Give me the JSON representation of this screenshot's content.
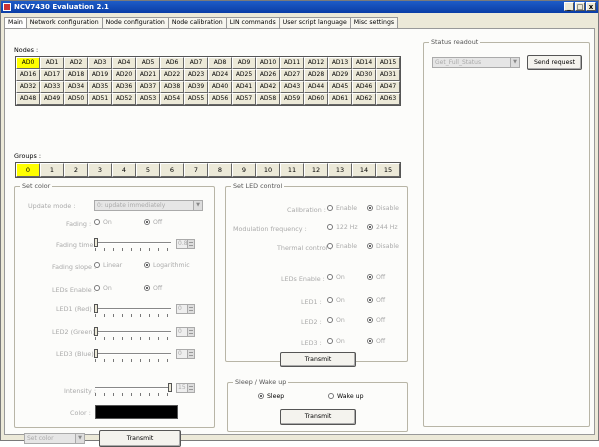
{
  "window": {
    "title": "NCV7430 Evaluation 2.1",
    "min": "_",
    "max": "□",
    "close": "x"
  },
  "tabs": [
    "Main",
    "Network configuration",
    "Node configuration",
    "Node calibration",
    "LIN commands",
    "User script language",
    "Misc settings"
  ],
  "nodes": {
    "label": "Nodes :",
    "selected": "AD0",
    "items": [
      "AD0",
      "AD1",
      "AD2",
      "AD3",
      "AD4",
      "AD5",
      "AD6",
      "AD7",
      "AD8",
      "AD9",
      "AD10",
      "AD11",
      "AD12",
      "AD13",
      "AD14",
      "AD15",
      "AD16",
      "AD17",
      "AD18",
      "AD19",
      "AD20",
      "AD21",
      "AD22",
      "AD23",
      "AD24",
      "AD25",
      "AD26",
      "AD27",
      "AD28",
      "AD29",
      "AD30",
      "AD31",
      "AD32",
      "AD33",
      "AD34",
      "AD35",
      "AD36",
      "AD37",
      "AD38",
      "AD39",
      "AD40",
      "AD41",
      "AD42",
      "AD43",
      "AD44",
      "AD45",
      "AD46",
      "AD47",
      "AD48",
      "AD49",
      "AD50",
      "AD51",
      "AD52",
      "AD53",
      "AD54",
      "AD55",
      "AD56",
      "AD57",
      "AD58",
      "AD59",
      "AD60",
      "AD61",
      "AD62",
      "AD63"
    ]
  },
  "groups": {
    "label": "Groups :",
    "selected": "0",
    "items": [
      "0",
      "1",
      "2",
      "3",
      "4",
      "5",
      "6",
      "7",
      "8",
      "9",
      "10",
      "11",
      "12",
      "13",
      "14",
      "15"
    ]
  },
  "set_color": {
    "title": "Set color",
    "update_mode_label": "Update mode :",
    "update_mode_value": "0: update immediately",
    "fading_label": "Fading :",
    "fading_on": "On",
    "fading_off": "Off",
    "fading_time_label": "Fading time :",
    "fading_time_value": "0.8",
    "fading_slope_label": "Fading slope :",
    "slope_linear": "Linear",
    "slope_log": "Logarithmic",
    "leds_enable_label": "LEDs Enable :",
    "leds_on": "On",
    "leds_off": "Off",
    "led1_label": "LED1 (Red) :",
    "led1_value": "0",
    "led2_label": "LED2 (Green) :",
    "led2_value": "0",
    "led3_label": "LED3 (Blue) :",
    "led3_value": "0",
    "intensity_label": "Intensity :",
    "intensity_value": "15",
    "color_label": "Color :",
    "color_hex": "#000000",
    "command_value": "Set color",
    "transmit": "Transmit"
  },
  "set_led_control": {
    "title": "Set LED control",
    "calibration_label": "Calibration :",
    "enable": "Enable",
    "disable": "Disable",
    "mod_freq_label": "Modulation frequency :",
    "freq_122": "122 Hz",
    "freq_244": "244 Hz",
    "thermal_label": "Thermal control :",
    "leds_enable_label": "LEDs Enable :",
    "on": "On",
    "off": "Off",
    "led1_label": "LED1 :",
    "led2_label": "LED2 :",
    "led3_label": "LED3 :",
    "transmit": "Transmit"
  },
  "sleep_wake": {
    "title": "Sleep / Wake up",
    "sleep": "Sleep",
    "wake": "Wake up",
    "transmit": "Transmit"
  },
  "status_readout": {
    "title": "Status readout",
    "combo_value": "Get_Full_Status",
    "send": "Send request"
  }
}
